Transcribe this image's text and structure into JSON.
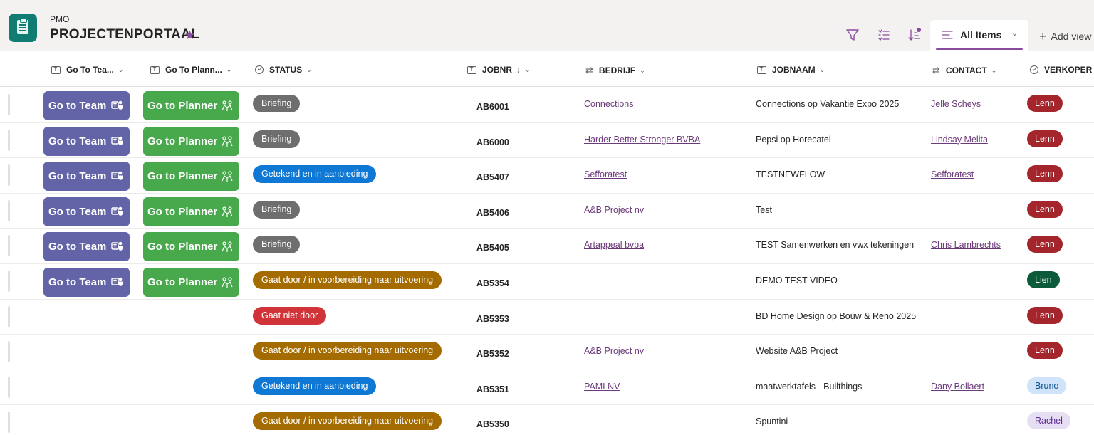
{
  "header": {
    "site": "PMO",
    "title": "PROJECTENPORTAAL",
    "view_tab": "All Items",
    "add_view": "Add view"
  },
  "colors": {
    "accent": "#8a4a9e",
    "team": "#6264a7",
    "planner": "#48a84c",
    "briefing": "#6e6e6e",
    "getekend": "#0f78d4",
    "gaat_door": "#a36b00",
    "gaat_niet": "#d13438"
  },
  "columns": [
    {
      "label": "Go To Tea..."
    },
    {
      "label": "Go To Plann..."
    },
    {
      "label": "STATUS"
    },
    {
      "label": "JOBNR"
    },
    {
      "label": "BEDRIJF"
    },
    {
      "label": "JOBNAAM"
    },
    {
      "label": "CONTACT"
    },
    {
      "label": "VERKOPER"
    }
  ],
  "buttons": {
    "team": "Go to Team",
    "planner": "Go to Planner"
  },
  "rows": [
    {
      "team": true,
      "status": "Briefing",
      "status_type": "briefing",
      "jobnr": "AB6001",
      "bedrijf": "Connections",
      "jobnaam": "Connections op Vakantie Expo 2025",
      "contact": "Jelle Scheys",
      "verkoper": "Lenn",
      "verkoper_type": "red"
    },
    {
      "team": true,
      "status": "Briefing",
      "status_type": "briefing",
      "jobnr": "AB6000",
      "bedrijf": "Harder Better Stronger BVBA",
      "jobnaam": "Pepsi op Horecatel",
      "contact": "Lindsay Melita",
      "verkoper": "Lenn",
      "verkoper_type": "red"
    },
    {
      "team": true,
      "status": "Getekend en in aanbieding",
      "status_type": "getekend",
      "jobnr": "AB5407",
      "bedrijf": "Sefforatest",
      "jobnaam": "TESTNEWFLOW",
      "contact": "Sefforatest",
      "verkoper": "Lenn",
      "verkoper_type": "red"
    },
    {
      "team": true,
      "status": "Briefing",
      "status_type": "briefing",
      "jobnr": "AB5406",
      "bedrijf": "A&B Project nv",
      "jobnaam": "Test",
      "contact": "",
      "verkoper": "Lenn",
      "verkoper_type": "red"
    },
    {
      "team": true,
      "status": "Briefing",
      "status_type": "briefing",
      "jobnr": "AB5405",
      "bedrijf": "Artappeal bvba",
      "jobnaam": "TEST Samenwerken en vwx tekeningen",
      "contact": "Chris Lambrechts",
      "verkoper": "Lenn",
      "verkoper_type": "red"
    },
    {
      "team": true,
      "status": "Gaat door / in voorbereiding naar uitvoering",
      "status_type": "gaat_door",
      "jobnr": "AB5354",
      "bedrijf": "",
      "jobnaam": "DEMO TEST VIDEO",
      "contact": "",
      "verkoper": "Lien",
      "verkoper_type": "green"
    },
    {
      "team": false,
      "status": "Gaat niet door",
      "status_type": "gaat_niet",
      "jobnr": "AB5353",
      "bedrijf": "",
      "jobnaam": "BD Home Design op Bouw & Reno 2025",
      "contact": "",
      "verkoper": "Lenn",
      "verkoper_type": "red"
    },
    {
      "team": false,
      "status": "Gaat door / in voorbereiding naar uitvoering",
      "status_type": "gaat_door",
      "jobnr": "AB5352",
      "bedrijf": "A&B Project nv",
      "jobnaam": "Website A&B Project",
      "contact": "",
      "verkoper": "Lenn",
      "verkoper_type": "red"
    },
    {
      "team": false,
      "status": "Getekend en in aanbieding",
      "status_type": "getekend",
      "jobnr": "AB5351",
      "bedrijf": "PAMI NV",
      "jobnaam": "maatwerktafels - Builthings",
      "contact": "Dany Bollaert",
      "verkoper": "Bruno",
      "verkoper_type": "lightblue"
    },
    {
      "team": false,
      "status": "Gaat door / in voorbereiding naar uitvoering",
      "status_type": "gaat_door",
      "jobnr": "AB5350",
      "bedrijf": "",
      "jobnaam": "Spuntini",
      "contact": "",
      "verkoper": "Rachel",
      "verkoper_type": "lavender"
    }
  ]
}
